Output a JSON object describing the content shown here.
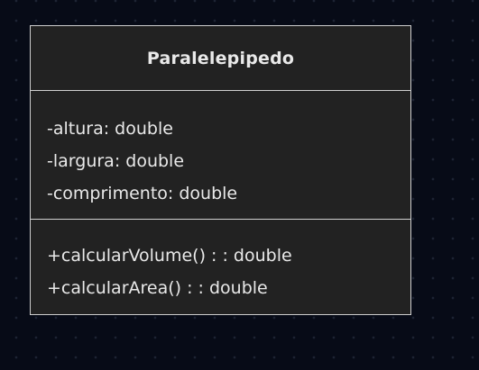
{
  "class": {
    "name": "Paralelepipedo",
    "attributes": [
      "-altura: double",
      "-largura: double",
      "-comprimento: double"
    ],
    "methods": [
      "+calcularVolume() : : double",
      "+calcularArea() : : double"
    ]
  },
  "colors": {
    "canvas_background": "#070b17",
    "box_fill": "#222222",
    "box_border": "#cfcfcf",
    "text": "#e9e9e9"
  }
}
